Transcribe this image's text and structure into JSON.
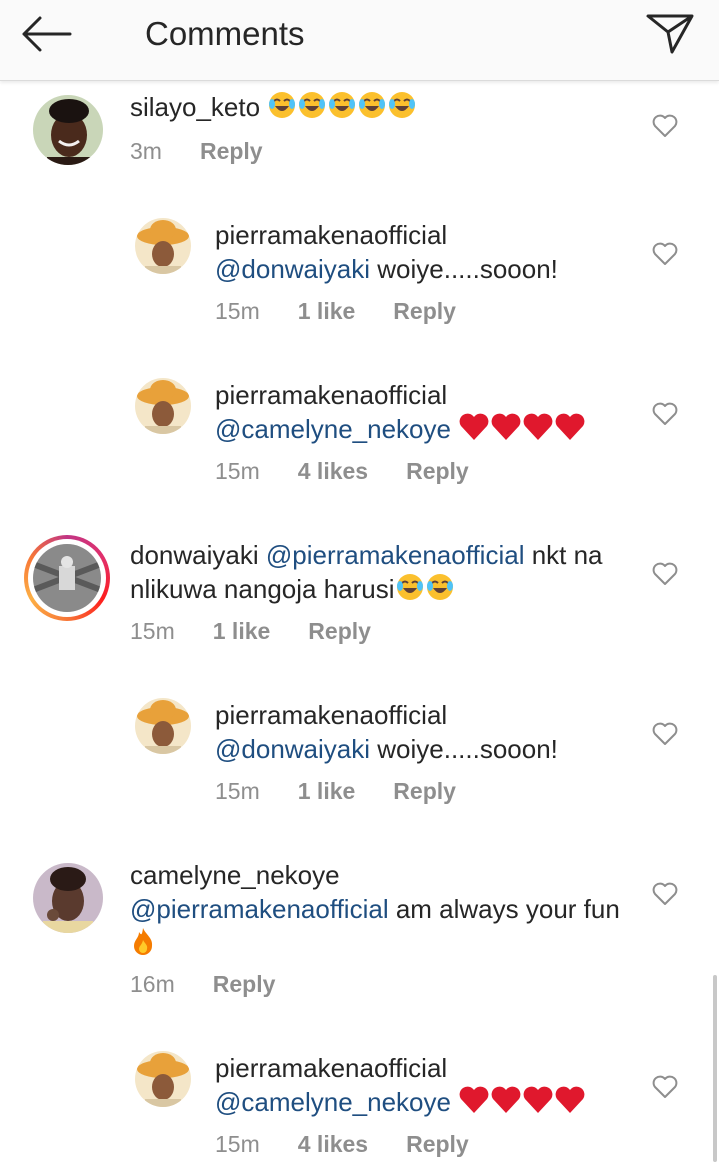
{
  "header": {
    "title": "Comments"
  },
  "comments": [
    {
      "username": "silayo_keto",
      "mention": "",
      "body": "",
      "time": "3m",
      "likes": "",
      "reply": "Reply"
    },
    {
      "username": "pierramakenaofficial",
      "mention": "@donwaiyaki",
      "body": " woiye.....sooon!",
      "time": "15m",
      "likes": "1 like",
      "reply": "Reply"
    },
    {
      "username": "pierramakenaofficial",
      "mention": "@camelyne_nekoye",
      "body": "",
      "time": "15m",
      "likes": "4 likes",
      "reply": "Reply"
    },
    {
      "username": "donwaiyaki",
      "mention": "@pierramakenaofficial",
      "body": " nkt na nlikuwa nangoja harusi",
      "time": "15m",
      "likes": "1 like",
      "reply": "Reply"
    },
    {
      "username": "pierramakenaofficial",
      "mention": "@donwaiyaki",
      "body": " woiye.....sooon!",
      "time": "15m",
      "likes": "1 like",
      "reply": "Reply"
    },
    {
      "username": "camelyne_nekoye",
      "mention": "@pierramakenaofficial",
      "body": " am always your fun",
      "time": "16m",
      "likes": "",
      "reply": "Reply"
    },
    {
      "username": "pierramakenaofficial",
      "mention": "@camelyne_nekoye",
      "body": "",
      "time": "15m",
      "likes": "4 likes",
      "reply": "Reply"
    }
  ],
  "icons": {
    "back": "arrow-left-icon",
    "share": "paper-plane-icon",
    "like": "heart-outline-icon",
    "laugh": "face-with-tears-of-joy-emoji",
    "heart": "red-heart-emoji",
    "fire": "fire-emoji"
  },
  "colors": {
    "mention": "#1f4e80",
    "meta": "#8e8e8e",
    "heart_emoji": "#e0182d"
  }
}
